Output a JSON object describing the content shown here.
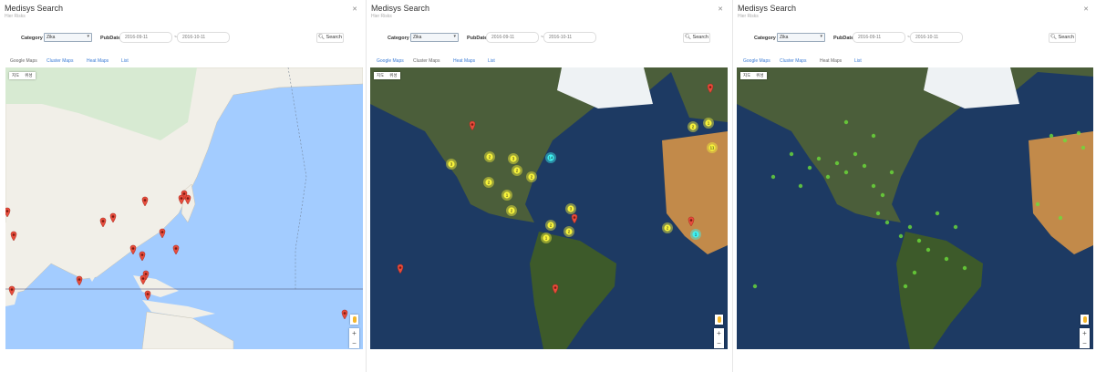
{
  "panels": [
    {
      "title": "Medisys Search",
      "subtitle": "Hier Risks",
      "category_label": "Category",
      "category_value": "Zika",
      "pubdate_label": "PubDate",
      "date_from": "2016-09-11",
      "date_to": "2016-10-11",
      "search_label": "Search",
      "tabs": [
        "Google Maps",
        "Cluster Maps",
        "Heat Maps",
        "List"
      ],
      "maptype": [
        "지도",
        "위성"
      ],
      "view": "Google Maps"
    },
    {
      "title": "Medisys Search",
      "subtitle": "Hier Risks",
      "category_label": "Category",
      "category_value": "Zika",
      "pubdate_label": "PubDate",
      "date_from": "2016-09-11",
      "date_to": "2016-10-11",
      "search_label": "Search",
      "tabs": [
        "Google Maps",
        "Cluster Maps",
        "Heat Maps",
        "List"
      ],
      "maptype": [
        "지도",
        "위성"
      ],
      "view": "Cluster Maps"
    },
    {
      "title": "Medisys Search",
      "subtitle": "Hier Risks",
      "category_label": "Category",
      "category_value": "Zika",
      "pubdate_label": "PubDate",
      "date_from": "2016-09-11",
      "date_to": "2016-10-11",
      "search_label": "Search",
      "tabs": [
        "Google Maps",
        "Cluster Maps",
        "Heat Maps",
        "List"
      ],
      "maptype": [
        "지도",
        "위성"
      ],
      "view": "Heat Maps"
    }
  ],
  "colors": {
    "accent": "#3a7bd5",
    "marker": "#e74c3c",
    "ocean_roadmap": "#a3ccff",
    "land_roadmap": "#f1efe8",
    "ocean_satellite": "#1d3a63",
    "cluster_yellow": "#f6f23a",
    "cluster_cyan": "#3ef1f2",
    "heat_green": "#6cdc3a"
  },
  "cluster_counts": [
    "3",
    "2",
    "3",
    "2",
    "2",
    "2",
    "1",
    "2",
    "3",
    "2",
    "1",
    "2",
    "1",
    "2",
    "11",
    "2",
    "1",
    "14"
  ],
  "icons": [
    "close-icon",
    "search-icon",
    "chevron-down-icon",
    "pegman-icon",
    "zoom-in-icon",
    "zoom-out-icon",
    "map-marker-icon"
  ]
}
